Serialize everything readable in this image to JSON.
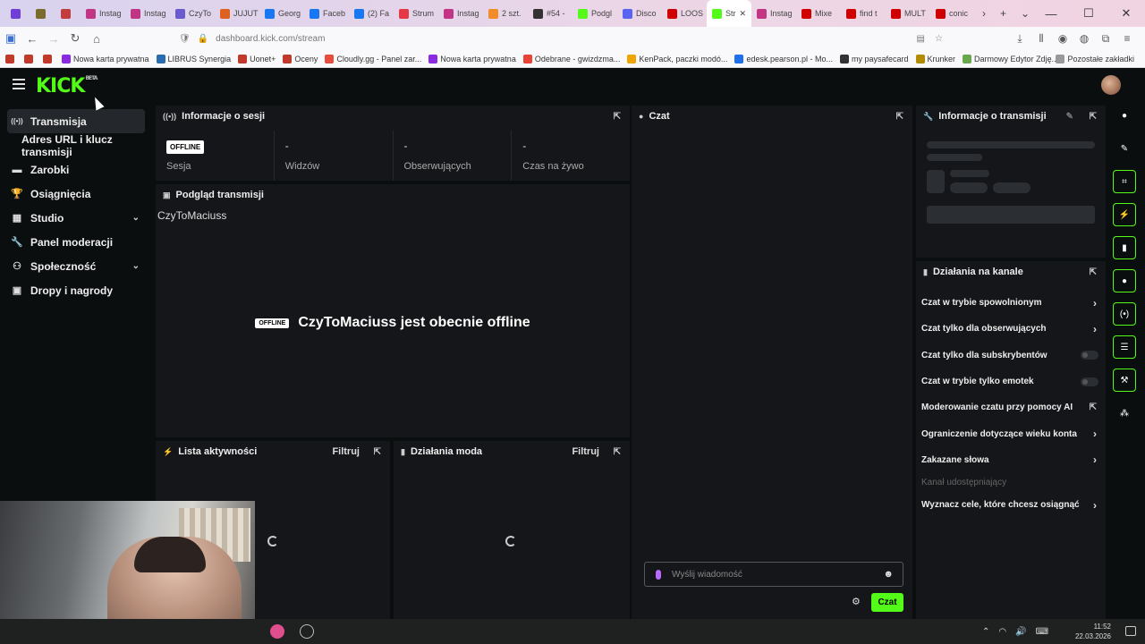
{
  "browser": {
    "tabs": [
      {
        "label": "",
        "color": "#6f3fd6"
      },
      {
        "label": "",
        "color": "#7b6c2b"
      },
      {
        "label": "",
        "color": "#c23d3d"
      },
      {
        "label": "Instag",
        "color": "#c13584"
      },
      {
        "label": "Instag",
        "color": "#c13584"
      },
      {
        "label": "CzyTo",
        "color": "#6a5acd"
      },
      {
        "label": "JUJUT",
        "color": "#e06020"
      },
      {
        "label": "Georg",
        "color": "#1877f2"
      },
      {
        "label": "Faceb",
        "color": "#1877f2"
      },
      {
        "label": "(2) Fa",
        "color": "#1877f2"
      },
      {
        "label": "Strum",
        "color": "#e63946"
      },
      {
        "label": "Instag",
        "color": "#c13584"
      },
      {
        "label": "2 szt.",
        "color": "#f28c28"
      },
      {
        "label": "#54 -",
        "color": "#333333"
      },
      {
        "label": "Podgl",
        "color": "#53fc18"
      },
      {
        "label": "Disco",
        "color": "#5865f2"
      },
      {
        "label": "LOOS",
        "color": "#d00000"
      },
      {
        "label": "Str",
        "color": "#53fc18"
      },
      {
        "label": "Instag",
        "color": "#c13584"
      },
      {
        "label": "Mixe",
        "color": "#d00000"
      },
      {
        "label": "find t",
        "color": "#d00000"
      },
      {
        "label": "MULT",
        "color": "#d00000"
      },
      {
        "label": "conic",
        "color": "#d00000"
      }
    ],
    "active_tab_index": 17,
    "url": "dashboard.kick.com/stream",
    "bookmarks": [
      {
        "label": "Nowa karta prywatna",
        "color": "#8a2be2"
      },
      {
        "label": "LIBRUS Synergia",
        "color": "#2b6cb0"
      },
      {
        "label": "Uonet+",
        "color": "#c0392b"
      },
      {
        "label": "Oceny",
        "color": "#c0392b"
      },
      {
        "label": "Cloudly.gg - Panel zar...",
        "color": "#e74c3c"
      },
      {
        "label": "Nowa karta prywatna",
        "color": "#8a2be2"
      },
      {
        "label": "Odebrane - gwizdzma...",
        "color": "#ea4335"
      },
      {
        "label": "KenPack, paczki modó...",
        "color": "#f0a500"
      },
      {
        "label": "edesk.pearson.pl - Mo...",
        "color": "#1f6feb"
      },
      {
        "label": "my paysafecard",
        "color": "#333333"
      },
      {
        "label": "Krunker",
        "color": "#b38b00"
      },
      {
        "label": "Darmowy Edytor Zdję...",
        "color": "#6aa84f"
      }
    ],
    "other_bookmarks": "Pozostałe zakładki"
  },
  "app": {
    "logo": "KICK",
    "logo_badge": "BETA",
    "accent": "#53fc18"
  },
  "sidebar": {
    "items": [
      {
        "label": "Transmisja",
        "icon": "broadcast-icon",
        "active": true
      },
      {
        "label": "Adres URL i klucz transmisji",
        "sub": true
      },
      {
        "label": "Zarobki",
        "icon": "wallet-icon"
      },
      {
        "label": "Osiągnięcia",
        "icon": "trophy-icon"
      },
      {
        "label": "Studio",
        "icon": "studio-icon",
        "expandable": true
      },
      {
        "label": "Panel moderacji",
        "icon": "wrench-icon"
      },
      {
        "label": "Społeczność",
        "icon": "community-icon",
        "expandable": true
      },
      {
        "label": "Dropy i nagrody",
        "icon": "drops-icon"
      }
    ]
  },
  "session": {
    "title": "Informacje o sesji",
    "status_badge": "OFFLINE",
    "status_label": "Sesja",
    "viewers_value": "-",
    "viewers_label": "Widzów",
    "followers_value": "-",
    "followers_label": "Obserwujących",
    "live_time_value": "-",
    "live_time_label": "Czas na żywo"
  },
  "preview": {
    "title": "Podgląd transmisji",
    "channel_name": "CzyToMaciuss",
    "badge": "OFFLINE",
    "message": "CzyToMaciuss jest obecnie offline"
  },
  "activity": {
    "title": "Lista aktywności",
    "filter": "Filtruj"
  },
  "mod_actions": {
    "title": "Działania moda",
    "filter": "Filtruj"
  },
  "chat": {
    "title": "Czat",
    "placeholder": "Wyślij wiadomość",
    "send_label": "Czat"
  },
  "stream_info": {
    "title": "Informacje o transmisji"
  },
  "channel_actions": {
    "title": "Działania na kanale",
    "items": [
      {
        "label": "Czat w trybie spowolnionym",
        "control": "chevron"
      },
      {
        "label": "Czat tylko dla obserwujących",
        "control": "chevron"
      },
      {
        "label": "Czat tylko dla subskrybentów",
        "control": "toggle"
      },
      {
        "label": "Czat w trybie tylko emotek",
        "control": "toggle"
      },
      {
        "label": "Moderowanie czatu przy pomocy AI",
        "control": "external"
      },
      {
        "label": "Ograniczenie dotyczące wieku konta",
        "control": "chevron"
      },
      {
        "label": "Zakazane słowa",
        "control": "chevron"
      },
      {
        "label": "Kanał udostępniający",
        "control": "none"
      },
      {
        "label": "Wyznacz cele, które chcesz osiągnąć",
        "control": "chevron"
      }
    ]
  },
  "taskbar": {
    "time": "11:52",
    "date": "22.03.2026"
  }
}
